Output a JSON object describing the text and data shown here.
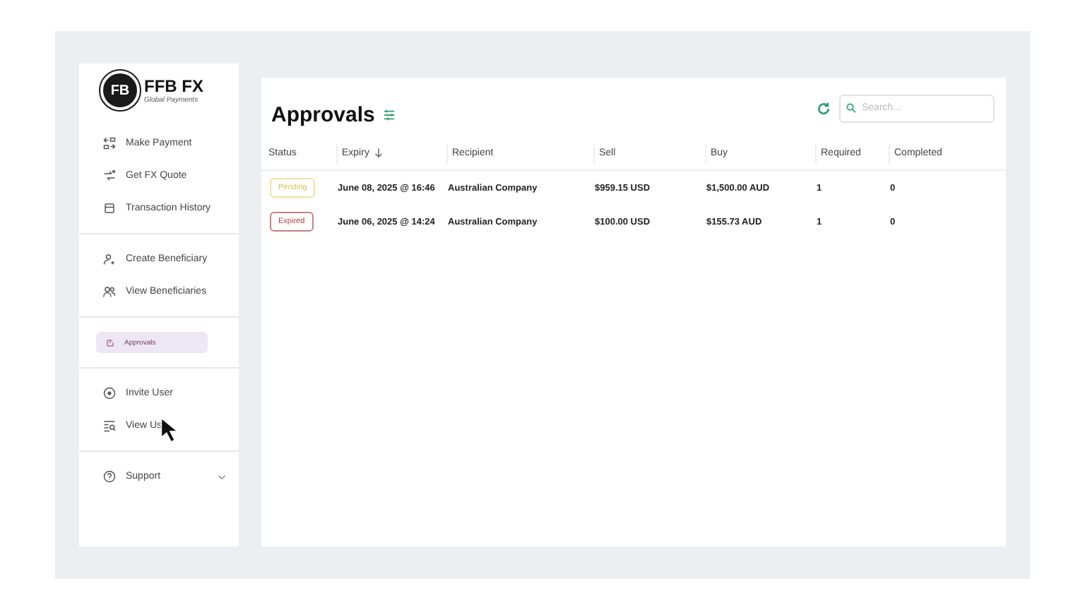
{
  "brand": {
    "name": "FFB FX",
    "tagline": "Global Payments",
    "logo_text": "FB"
  },
  "sidebar": {
    "groups": [
      {
        "items": [
          {
            "label": "Make Payment",
            "selected": false
          },
          {
            "label": "Get FX Quote",
            "selected": false
          },
          {
            "label": "Transaction History",
            "selected": false
          }
        ]
      },
      {
        "items": [
          {
            "label": "Create Beneficiary",
            "selected": false
          },
          {
            "label": "View Beneficiaries",
            "selected": false
          }
        ]
      },
      {
        "items": [
          {
            "label": "Approvals",
            "selected": true
          }
        ]
      },
      {
        "items": [
          {
            "label": "Invite User",
            "selected": false
          },
          {
            "label": "View Us",
            "selected": false
          }
        ]
      },
      {
        "items": [
          {
            "label": "Support",
            "selected": false,
            "expandable": true
          }
        ]
      }
    ]
  },
  "page": {
    "title": "Approvals",
    "search": {
      "placeholder": "Search..."
    }
  },
  "table": {
    "columns": [
      {
        "label": "Status",
        "sorted": false
      },
      {
        "label": "Expiry",
        "sorted": true
      },
      {
        "label": "Recipient",
        "sorted": false
      },
      {
        "label": "Sell",
        "sorted": false
      },
      {
        "label": "Buy",
        "sorted": false
      },
      {
        "label": "Required",
        "sorted": false
      },
      {
        "label": "Completed",
        "sorted": false
      }
    ],
    "rows": [
      {
        "status": "Pending",
        "kind": "pending",
        "expiry": "June 08, 2025 @ 16:46",
        "recipient": "Australian Company",
        "sell": "$959.15 USD",
        "buy": "$1,500.00 AUD",
        "required": "1",
        "completed": "0"
      },
      {
        "status": "Expired",
        "kind": "expired",
        "expiry": "June 06, 2025 @ 14:24",
        "recipient": "Australian Company",
        "sell": "$100.00 USD",
        "buy": "$155.73 AUD",
        "required": "1",
        "completed": "0"
      }
    ]
  }
}
